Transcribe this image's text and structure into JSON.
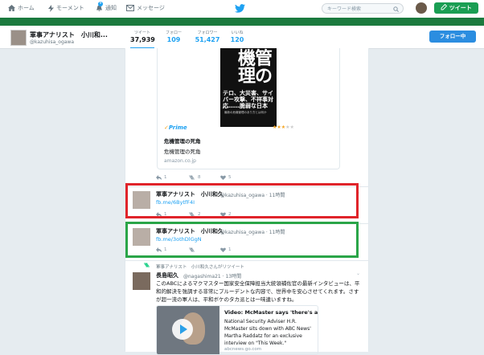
{
  "nav": {
    "home": "ホーム",
    "moments": "モーメント",
    "notifications": "通知",
    "notifications_badge": "9",
    "messages": "メッセージ",
    "search_placeholder": "キーワード検索",
    "tweet_button": "ツイート"
  },
  "profile": {
    "name": "軍事アナリスト　小川和...",
    "handle": "@kazuhisa_ogawa",
    "stats": [
      {
        "label": "ツイート",
        "value": "37,939"
      },
      {
        "label": "フォロー",
        "value": "109"
      },
      {
        "label": "フォロワー",
        "value": "51,427"
      },
      {
        "label": "いいね",
        "value": "120"
      }
    ],
    "follow_button": "フォロー中"
  },
  "card": {
    "book_title_big": "機管理の",
    "book_subtitle": "テロ、大災害、サイバー攻撃、不祥事対応……脆弱な日本",
    "book_small": "最新の危機管理のあり方とは何か",
    "prime_label": "Prime",
    "stars": 3,
    "title": "危機管理の死角",
    "description": "危機管理の死角",
    "url": "amazon.co.jp",
    "actions": {
      "reply": "1",
      "retweet": "8",
      "like": "5"
    }
  },
  "tweets": [
    {
      "name": "軍事アナリスト　小川和久",
      "handle": "@kazuhisa_ogawa · 11時間",
      "link": "fb.me/6BytfF4I",
      "actions": {
        "reply": "1",
        "retweet": "2",
        "like": "2"
      }
    },
    {
      "name": "軍事アナリスト　小川和久",
      "handle": "@kazuhisa_ogawa · 11時間",
      "link": "fb.me/3othDlGgN",
      "actions": {
        "reply": "1",
        "retweet": "",
        "like": "1"
      }
    }
  ],
  "retweet": {
    "retweeted_by": "軍事アナリスト　小川和久さんがリツイート",
    "name": "長島昭久",
    "handle": "@nagashima21 · 13時間",
    "body": "このABCによるマクマスター国家安全保障担当大統領補佐官の最新インタビューは、平和的解決を強調する非常にプルーデントな内容で、世界中を安心させてくれます。さすが超一流の軍人は、平和ボケのタカ派とは一味違いますね。",
    "media_title": "Video: McMaster says 'there's an international cons...",
    "media_desc": "National Security Adviser H.R. McMaster sits down with ABC News' Martha Raddatz for an exclusive interview on \"This Week.\"",
    "media_url": "abcnews.go.com"
  },
  "colors": {
    "accent": "#1da1f2",
    "green_brand": "#1b7a3e",
    "red_box": "#e0242a",
    "green_box": "#2aa548"
  }
}
